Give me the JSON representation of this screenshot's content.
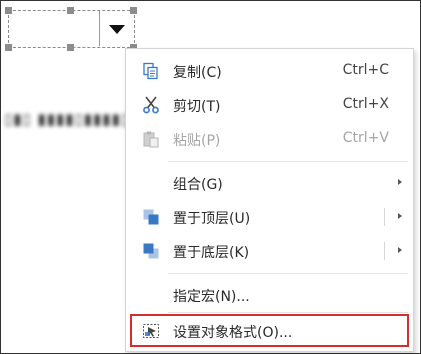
{
  "context_menu": {
    "items": [
      {
        "label": "复制(C)",
        "shortcut": "Ctrl+C",
        "icon": "copy-icon"
      },
      {
        "label": "剪切(T)",
        "shortcut": "Ctrl+X",
        "icon": "scissors-icon"
      },
      {
        "label": "粘贴(P)",
        "shortcut": "Ctrl+V",
        "icon": "paste-icon",
        "disabled": true
      },
      {
        "label": "组合(G)",
        "submenu": true
      },
      {
        "label": "置于顶层(U)",
        "submenu": true,
        "icon": "bring-to-front-icon"
      },
      {
        "label": "置于底层(K)",
        "submenu": true,
        "icon": "send-to-back-icon"
      },
      {
        "label": "指定宏(N)..."
      },
      {
        "label": "设置对象格式(O)...",
        "icon": "format-object-icon",
        "highlighted": true
      }
    ]
  },
  "colors": {
    "highlight_border": "#d32f2f",
    "icon_blue": "#3a78c3",
    "disabled_text": "#a5a5a5"
  }
}
